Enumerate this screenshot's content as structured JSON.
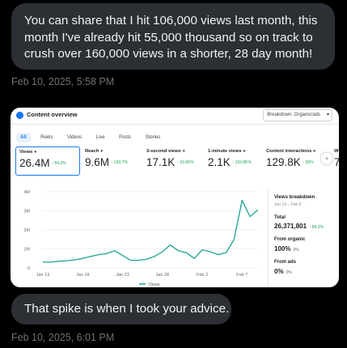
{
  "messages": [
    {
      "text": "You can share that I hit 106,000 views last month, this month I've already hit 55,000 thousand so on track to crush over 160,000 views in a shorter, 28 day month!",
      "timestamp": "Feb 10, 2025, 5:58 PM"
    },
    {
      "text": "That spike is when I took your advice.",
      "timestamp": "Feb 10, 2025, 6:01 PM"
    }
  ],
  "screenshot": {
    "title": "Content overview",
    "breakdown_select": "Breakdown: Organic/ads",
    "tabs": [
      "All",
      "Reels",
      "Videos",
      "Live",
      "Posts",
      "Stories"
    ],
    "active_tab": "All",
    "metrics": [
      {
        "label": "Views",
        "value": "26.4M",
        "change": "↑ 84.2%"
      },
      {
        "label": "Reach",
        "value": "9.6M",
        "change": "↑ 190.7%"
      },
      {
        "label": "3-second views",
        "value": "17.1K",
        "change": "↑ 15.6K%"
      },
      {
        "label": "1-minute views",
        "value": "2.1K",
        "change": "↑ 103.8K%"
      },
      {
        "label": "Content interactions",
        "value": "129.8K",
        "change": "↑ 95%"
      },
      {
        "label": "W",
        "value": "7",
        "change": ""
      }
    ],
    "panel": {
      "title": "Views breakdown",
      "range": "Jan 13 – Feb 9",
      "total_label": "Total",
      "total_value": "26,371,801",
      "total_change": "↑ 84.2%",
      "organic_label": "From organic",
      "organic_value": "100%",
      "organic_small": "0%",
      "ads_label": "From ads",
      "ads_value": "0%",
      "ads_small": "0%"
    },
    "chart_data": {
      "type": "line",
      "x": [
        "Jan 13",
        "Jan 14",
        "Jan 15",
        "Jan 16",
        "Jan 17",
        "Jan 18",
        "Jan 19",
        "Jan 20",
        "Jan 21",
        "Jan 22",
        "Jan 23",
        "Jan 24",
        "Jan 25",
        "Jan 26",
        "Jan 27",
        "Jan 28",
        "Jan 29",
        "Jan 30",
        "Jan 31",
        "Feb 1",
        "Feb 2",
        "Feb 3",
        "Feb 4",
        "Feb 5",
        "Feb 6",
        "Feb 7",
        "Feb 8",
        "Feb 9"
      ],
      "x_tick_labels": [
        "Jan 13",
        "Jan 18",
        "Jan 23",
        "Jan 28",
        "Feb 2",
        "Feb 7"
      ],
      "y_tick_labels": [
        "0",
        "1M",
        "2M",
        "3M",
        "4M"
      ],
      "ylim": [
        0,
        4000000
      ],
      "series": [
        {
          "name": "Views",
          "color": "#1aa391",
          "values": [
            300000,
            300000,
            350000,
            380000,
            420000,
            500000,
            600000,
            700000,
            750000,
            900000,
            650000,
            400000,
            400000,
            450000,
            600000,
            850000,
            1200000,
            900000,
            800000,
            500000,
            950000,
            850000,
            700000,
            800000,
            1500000,
            3550000,
            2700000,
            3050000
          ]
        }
      ],
      "legend": "bottom"
    }
  }
}
